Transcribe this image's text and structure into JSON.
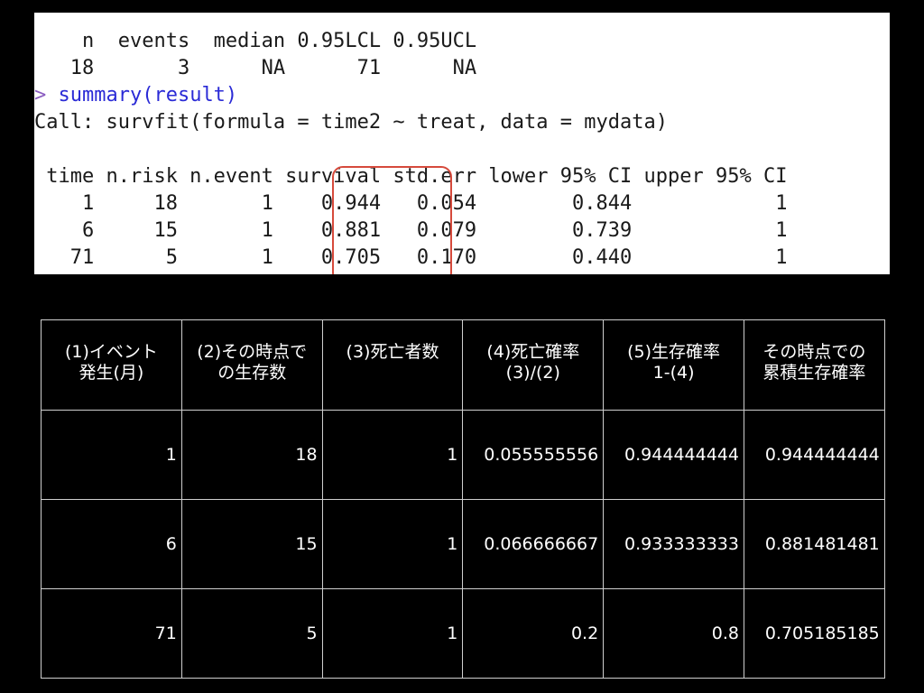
{
  "console": {
    "lines": [
      "    n  events  median 0.95LCL 0.95UCL",
      "   18       3      NA      71      NA",
      "summary(result)",
      "Call: survfit(formula = time2 ~ treat, data = mydata)",
      "",
      " time n.risk n.event survival std.err lower 95% CI upper 95% CI",
      "    1     18       1    0.944   0.054        0.844            1",
      "    6     15       1    0.881   0.079        0.739            1",
      "   71      5       1    0.705   0.170        0.440            1"
    ],
    "prompt": "> ",
    "colors": {
      "command": "#2b2bd6",
      "prompt": "#8a5cc0",
      "highlight": "#d64a3c"
    }
  },
  "table": {
    "headers": [
      [
        "(1)イベント",
        "発生(月)"
      ],
      [
        "(2)その時点で",
        "の生存数"
      ],
      [
        "(3)死亡者数"
      ],
      [
        "(4)死亡確率",
        "(3)/(2)"
      ],
      [
        "(5)生存確率",
        "1-(4)"
      ],
      [
        "その時点での",
        "累積生存確率"
      ]
    ],
    "rows": [
      [
        "1",
        "18",
        "1",
        "0.055555556",
        "0.944444444",
        "0.944444444"
      ],
      [
        "6",
        "15",
        "1",
        "0.066666667",
        "0.933333333",
        "0.881481481"
      ],
      [
        "71",
        "5",
        "1",
        "0.2",
        "0.8",
        "0.705185185"
      ]
    ]
  }
}
